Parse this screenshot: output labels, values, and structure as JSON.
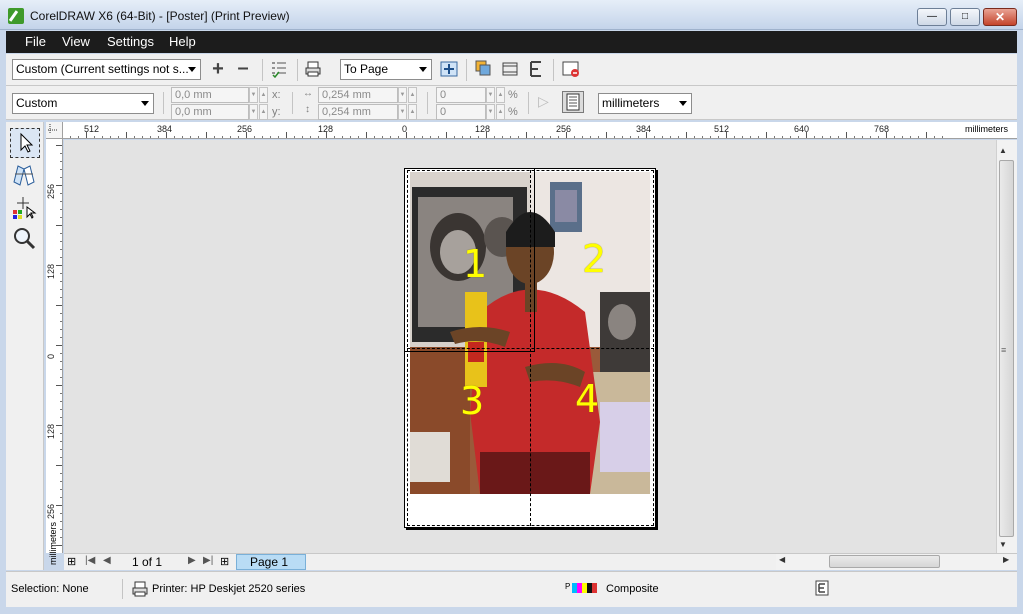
{
  "window": {
    "title": "CorelDRAW X6 (64-Bit) - [Poster] (Print Preview)",
    "minimize_glyph": "▭",
    "maximize_glyph": "□",
    "close_glyph": "✕"
  },
  "menu": {
    "file": "File",
    "view": "View",
    "settings": "Settings",
    "help": "Help"
  },
  "toolbar1": {
    "print_style": "Custom (Current settings not s...",
    "add_icon": "plus-icon",
    "remove_icon": "minus-icon",
    "fit_mode": "To Page"
  },
  "toolbar2": {
    "preset": "Custom",
    "width": "0,0 mm",
    "height": "0,0 mm",
    "x_label": "x:",
    "y_label": "y:",
    "pos_x": "0,254 mm",
    "pos_y": "0,254 mm",
    "scale_x": "0",
    "scale_y": "0",
    "pct_x": "%",
    "pct_y": "%",
    "units": "millimeters"
  },
  "rulers": {
    "units_label": "millimeters",
    "h_labels": [
      "512",
      "384",
      "256",
      "128",
      "0",
      "128",
      "256",
      "384",
      "512",
      "640",
      "768"
    ],
    "v_labels": [
      "256",
      "128",
      "0",
      "128",
      "256"
    ],
    "v_units_label": "millimeters"
  },
  "poster_tiles": [
    "1",
    "2",
    "3",
    "4"
  ],
  "navigation": {
    "page_count": "1 of 1",
    "page_tab": "Page 1"
  },
  "status": {
    "selection": "Selection: None",
    "printer": "Printer: HP Deskjet 2520 series",
    "composite": "Composite"
  },
  "colors": {
    "menubar_bg": "#1c1c1c",
    "tile_number": "#ffff00",
    "page_tab": "#b9dcf5"
  }
}
